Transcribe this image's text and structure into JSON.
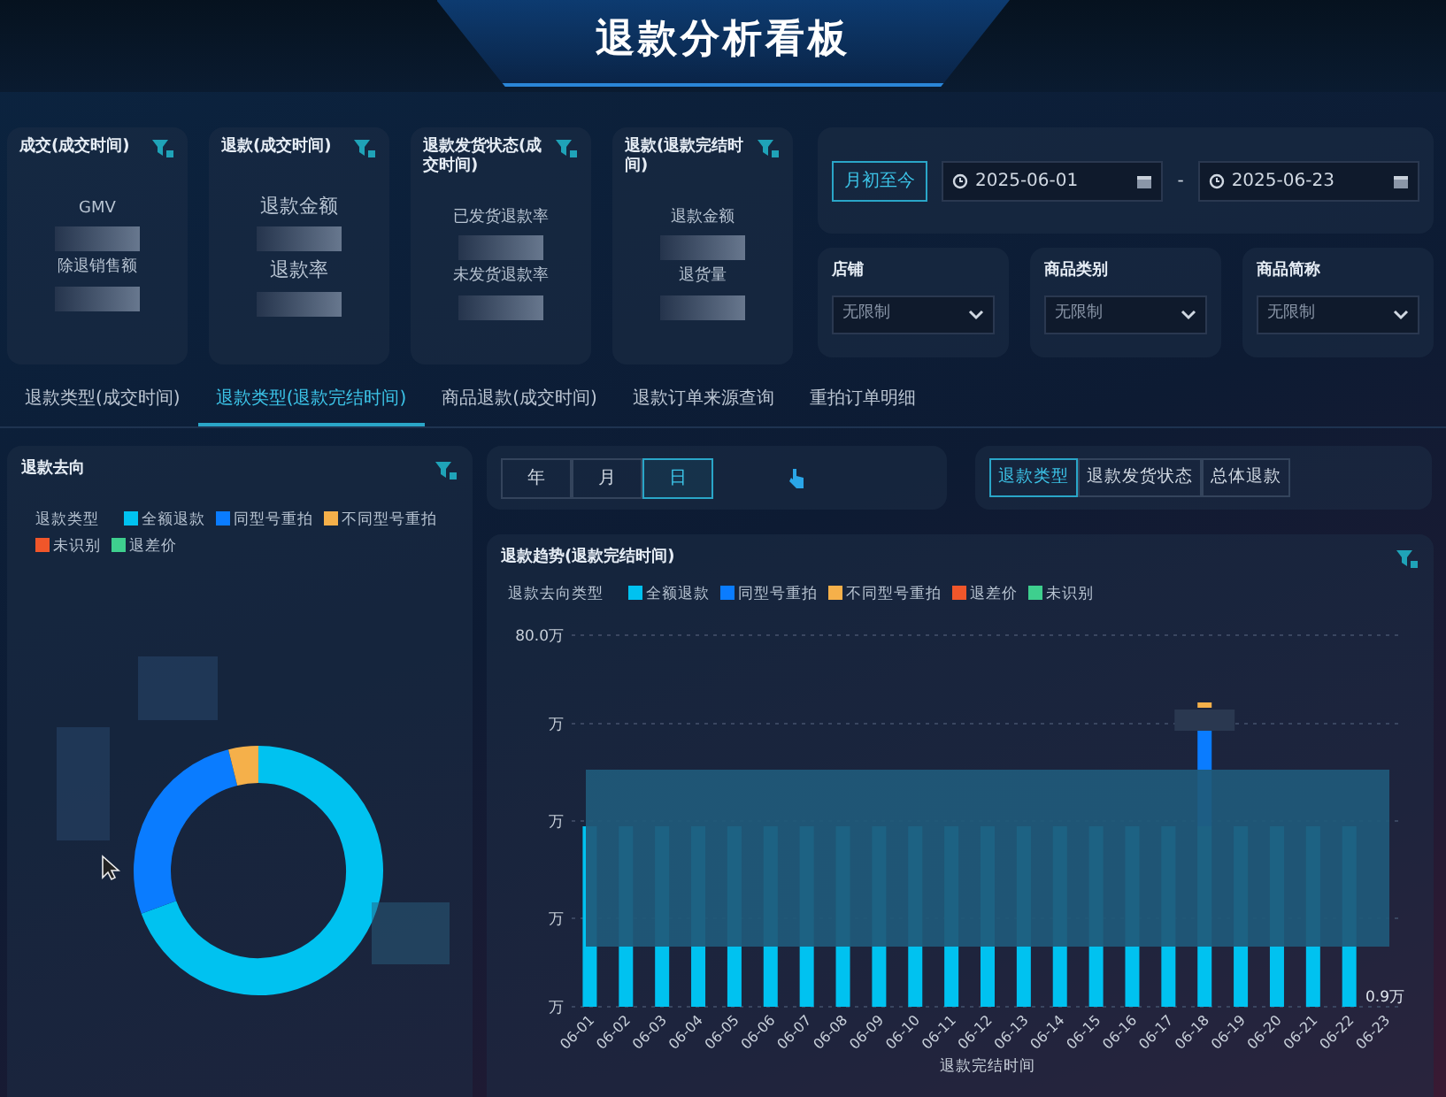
{
  "header": {
    "title": "退款分析看板"
  },
  "kpi_cards": [
    {
      "title": "成交(成交时间)",
      "metrics": [
        "GMV",
        "除退销售额"
      ]
    },
    {
      "title": "退款(成交时间)",
      "metrics": [
        "退款金额",
        "退款率"
      ]
    },
    {
      "title": "退款发货状态(成交时间)",
      "metrics": [
        "已发货退款率",
        "未发货退款率"
      ]
    },
    {
      "title": "退款(退款完结时间)",
      "metrics": [
        "退款金额",
        "退货量"
      ]
    }
  ],
  "date_filter": {
    "preset": "月初至今",
    "start": "2025-06-01",
    "separator": "-",
    "end": "2025-06-23"
  },
  "filters": [
    {
      "label": "店铺",
      "value": "无限制"
    },
    {
      "label": "商品类别",
      "value": "无限制"
    },
    {
      "label": "商品简称",
      "value": "无限制"
    }
  ],
  "tabs": [
    {
      "label": "退款类型(成交时间)",
      "selected": false
    },
    {
      "label": "退款类型(退款完结时间)",
      "selected": true
    },
    {
      "label": "商品退款(成交时间)",
      "selected": false
    },
    {
      "label": "退款订单来源查询",
      "selected": false
    },
    {
      "label": "重拍订单明细",
      "selected": false
    }
  ],
  "refund_destination": {
    "title": "退款去向",
    "legend_title": "退款类型",
    "legend": [
      {
        "label": "全额退款",
        "color": "#00c2f0"
      },
      {
        "label": "同型号重拍",
        "color": "#0a7cff"
      },
      {
        "label": "不同型号重拍",
        "color": "#f5b04a"
      },
      {
        "label": "未识别",
        "color": "#f0562a"
      },
      {
        "label": "退差价",
        "color": "#3ecf8e"
      }
    ]
  },
  "period_buttons": [
    {
      "label": "年",
      "selected": false
    },
    {
      "label": "月",
      "selected": false
    },
    {
      "label": "日",
      "selected": true
    }
  ],
  "view_buttons": [
    {
      "label": "退款类型",
      "selected": true
    },
    {
      "label": "退款发货状态",
      "selected": false
    },
    {
      "label": "总体退款",
      "selected": false
    }
  ],
  "trend": {
    "title": "退款趋势(退款完结时间)",
    "legend_title": "退款去向类型",
    "legend": [
      {
        "label": "全额退款",
        "color": "#00c2f0"
      },
      {
        "label": "同型号重拍",
        "color": "#0a7cff"
      },
      {
        "label": "不同型号重拍",
        "color": "#f5b04a"
      },
      {
        "label": "退差价",
        "color": "#f0562a"
      },
      {
        "label": "未识别",
        "color": "#3ecf8e"
      }
    ],
    "y_labels": [
      "80.0万",
      "万",
      "万",
      "万",
      "万"
    ],
    "x_labels": [
      "06-01",
      "06-02",
      "06-03",
      "06-04",
      "06-05",
      "06-06",
      "06-07",
      "06-08",
      "06-09",
      "06-10",
      "06-11",
      "06-12",
      "06-13",
      "06-14",
      "06-15",
      "06-16",
      "06-17",
      "06-18",
      "06-19",
      "06-20",
      "06-21",
      "06-22",
      "06-23"
    ],
    "end_label": "0.9万",
    "xlabel": "退款完结时间"
  }
}
